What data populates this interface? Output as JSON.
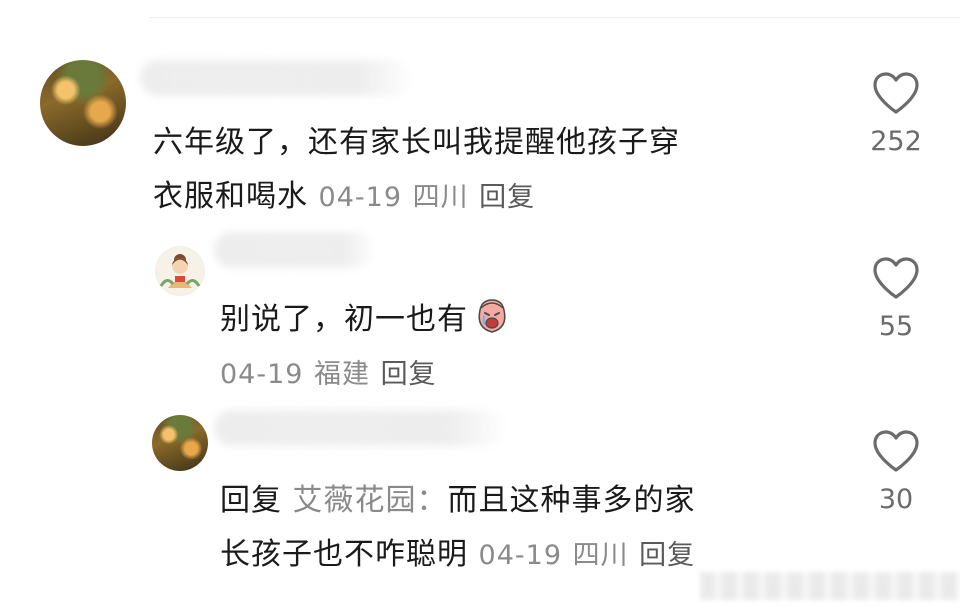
{
  "comments": [
    {
      "text": "六年级了，还有家长叫我提醒他孩子穿",
      "text2": "衣服和喝水",
      "date": "04-19",
      "location": "四川",
      "reply_label": "回复",
      "likes": "252"
    },
    {
      "text": "别说了，初一也有",
      "date": "04-19",
      "location": "福建",
      "reply_label": "回复",
      "likes": "55"
    },
    {
      "reply_prefix": "回复",
      "mention": "艾薇花园：",
      "text": "而且这种事多的家",
      "text2": "长孩子也不咋聪明",
      "date": "04-19",
      "location": "四川",
      "reply_label": "回复",
      "likes": "30"
    }
  ],
  "icons": {
    "like": "heart-outline-icon",
    "emoji": "crying-face-emoji-icon"
  },
  "colors": {
    "text": "#1a1a1a",
    "meta": "#8a8a8a",
    "heart": "#6b6b6b"
  }
}
